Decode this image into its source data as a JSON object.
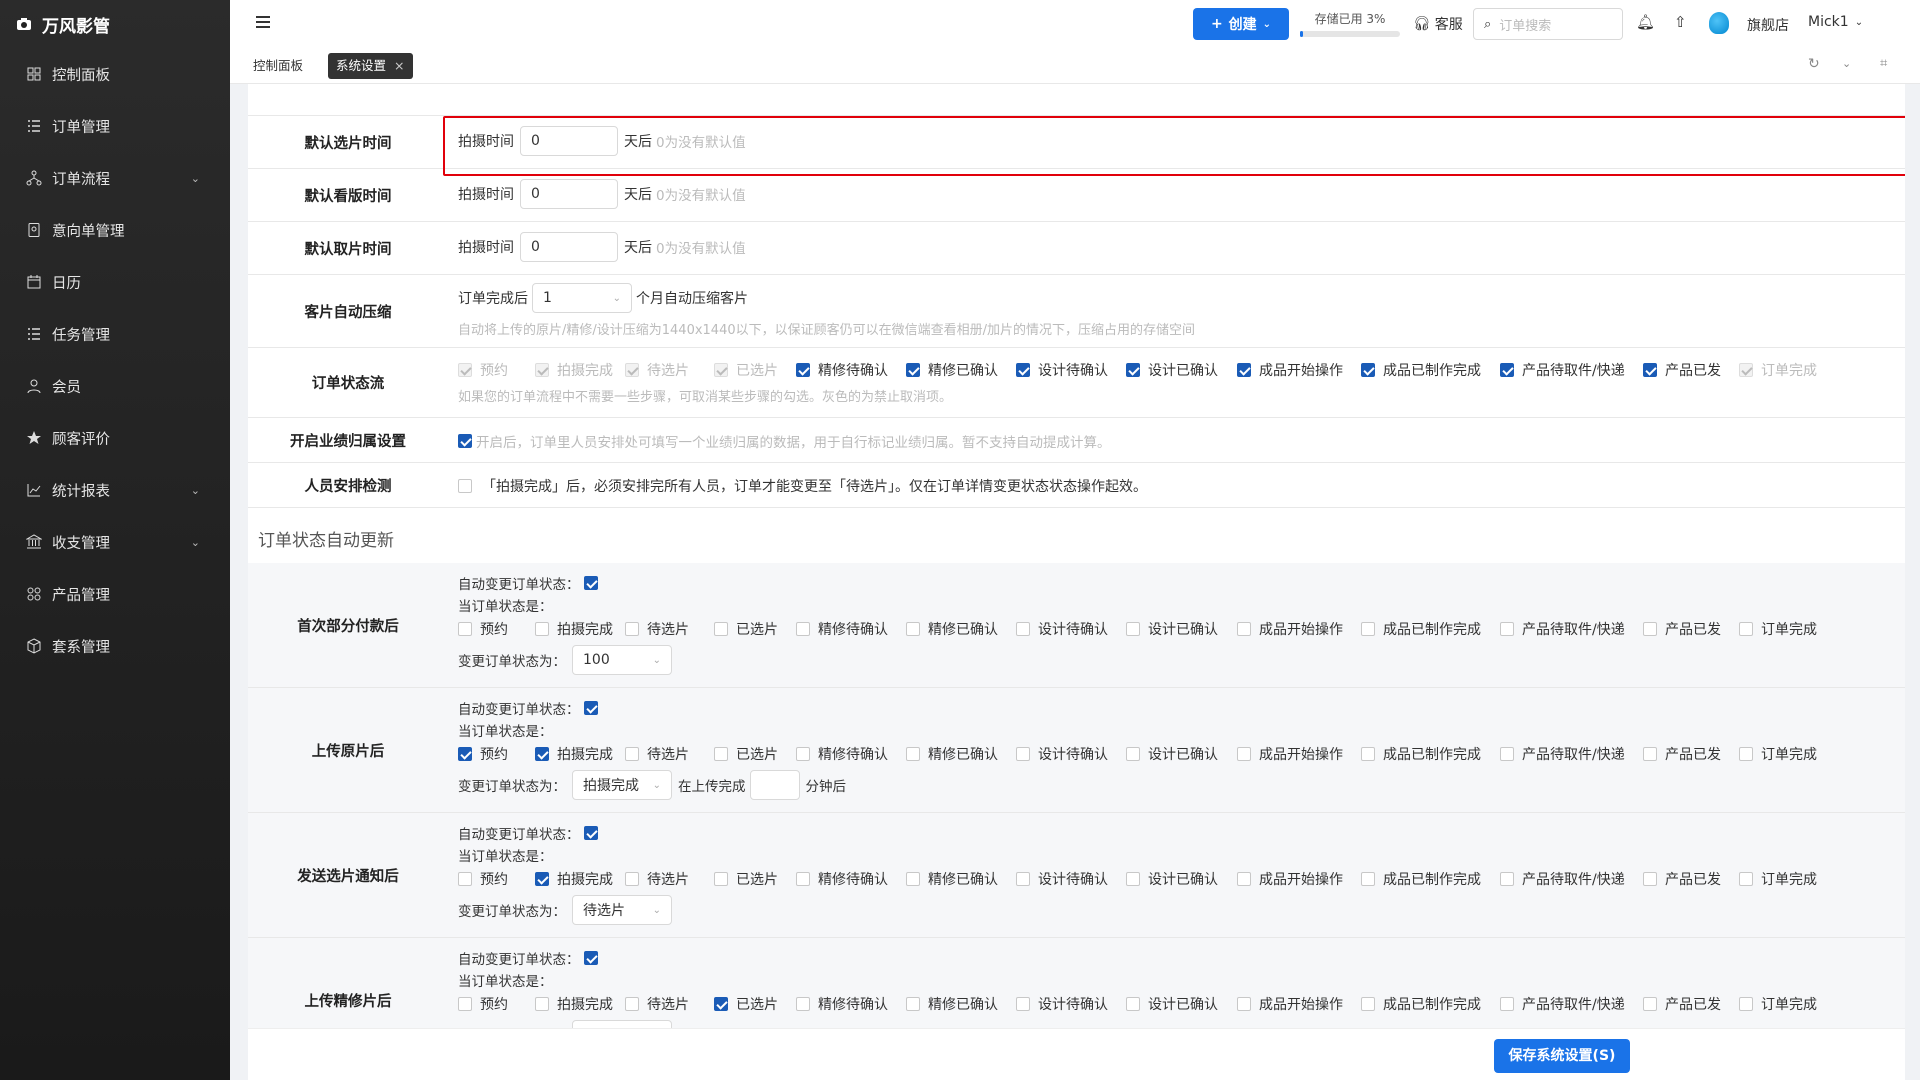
{
  "app": {
    "brand": "万风影管"
  },
  "sidebar": {
    "items": [
      {
        "label": "控制面板",
        "icon": "dashboard-icon"
      },
      {
        "label": "订单管理",
        "icon": "list-icon"
      },
      {
        "label": "订单流程",
        "icon": "flow-icon",
        "arrow": "⌄"
      },
      {
        "label": "意向单管理",
        "icon": "document-icon"
      },
      {
        "label": "日历",
        "icon": "calendar-icon"
      },
      {
        "label": "任务管理",
        "icon": "list-icon"
      },
      {
        "label": "会员",
        "icon": "user-icon"
      },
      {
        "label": "顾客评价",
        "icon": "star-icon"
      },
      {
        "label": "统计报表",
        "icon": "chart-icon",
        "arrow": "⌄"
      },
      {
        "label": "收支管理",
        "icon": "bank-icon",
        "arrow": "⌄"
      },
      {
        "label": "产品管理",
        "icon": "grid-icon"
      },
      {
        "label": "套系管理",
        "icon": "package-icon"
      }
    ]
  },
  "topbar": {
    "create_label": "创建",
    "storage_label": "存储已用 3%",
    "storage_percent": 3,
    "service_label": "客服",
    "search_placeholder": "订单搜索",
    "store_label": "旗舰店",
    "user_label": "Mick1"
  },
  "tabs": [
    {
      "label": "控制面板",
      "active": false
    },
    {
      "label": "系统设置",
      "active": true,
      "close": "×"
    }
  ],
  "settings": {
    "days": [
      {
        "label": "默认选片时间",
        "prefix": "拍摄时间",
        "value": "0",
        "suffix": "天后",
        "hint": "0为没有默认值"
      },
      {
        "label": "默认看版时间",
        "prefix": "拍摄时间",
        "value": "0",
        "suffix": "天后",
        "hint": "0为没有默认值"
      },
      {
        "label": "默认取片时间",
        "prefix": "拍摄时间",
        "value": "0",
        "suffix": "天后",
        "hint": "0为没有默认值"
      }
    ],
    "compress": {
      "label": "客片自动压缩",
      "prefix": "订单完成后",
      "value": "1",
      "suffix": "个月自动压缩客片",
      "hint": "自动将上传的原片/精修/设计压缩为1440x1440以下，以保证顾客仍可以在微信端查看相册/加片的情况下，压缩占用的存储空间"
    },
    "flow": {
      "label": "订单状态流",
      "hint": "如果您的订单流程中不需要一些步骤，可取消某些步骤的勾选。灰色的为禁止取消项。",
      "options": [
        {
          "label": "预约",
          "state": "dis"
        },
        {
          "label": "拍摄完成",
          "state": "dis"
        },
        {
          "label": "待选片",
          "state": "dis"
        },
        {
          "label": "已选片",
          "state": "dis"
        },
        {
          "label": "精修待确认",
          "state": "on"
        },
        {
          "label": "精修已确认",
          "state": "on"
        },
        {
          "label": "设计待确认",
          "state": "on"
        },
        {
          "label": "设计已确认",
          "state": "on"
        },
        {
          "label": "成品开始操作",
          "state": "on"
        },
        {
          "label": "成品已制作完成",
          "state": "on"
        },
        {
          "label": "产品待取件/快递",
          "state": "on"
        },
        {
          "label": "产品已发",
          "state": "on"
        },
        {
          "label": "订单完成",
          "state": "dis"
        }
      ]
    },
    "perf": {
      "label": "开启业绩归属设置",
      "hint": "开启后，订单里人员安排处可填写一个业绩归属的数据，用于自行标记业绩归属。暂不支持自动提成计算。"
    },
    "staff": {
      "label": "人员安排检测",
      "text": "「拍摄完成」后，必须安排完所有人员，订单才能变更至「待选片」。仅在订单详情变更状态状态操作起效。"
    },
    "auto_title": "订单状态自动更新",
    "auto_change_label": "自动变更订单状态：",
    "current_label": "当订单状态是：",
    "change_to_label": "变更订单状态为：",
    "status_names": [
      "预约",
      "拍摄完成",
      "待选片",
      "已选片",
      "精修待确认",
      "精修已确认",
      "设计待确认",
      "设计已确认",
      "成品开始操作",
      "成品已制作完成",
      "产品待取件/快递",
      "产品已发",
      "订单完成"
    ],
    "auto": [
      {
        "label": "首次部分付款后",
        "checked": [],
        "target": "100"
      },
      {
        "label": "上传原片后",
        "checked": [
          0,
          1
        ],
        "target": "拍摄完成",
        "after_prefix": "在上传完成",
        "after_suffix": "分钟后"
      },
      {
        "label": "发送选片通知后",
        "checked": [
          1
        ],
        "target": "待选片"
      },
      {
        "label": "上传精修片后",
        "checked": [
          3
        ],
        "target": ""
      }
    ]
  },
  "footer": {
    "save_label": "保存系统设置(S)"
  }
}
